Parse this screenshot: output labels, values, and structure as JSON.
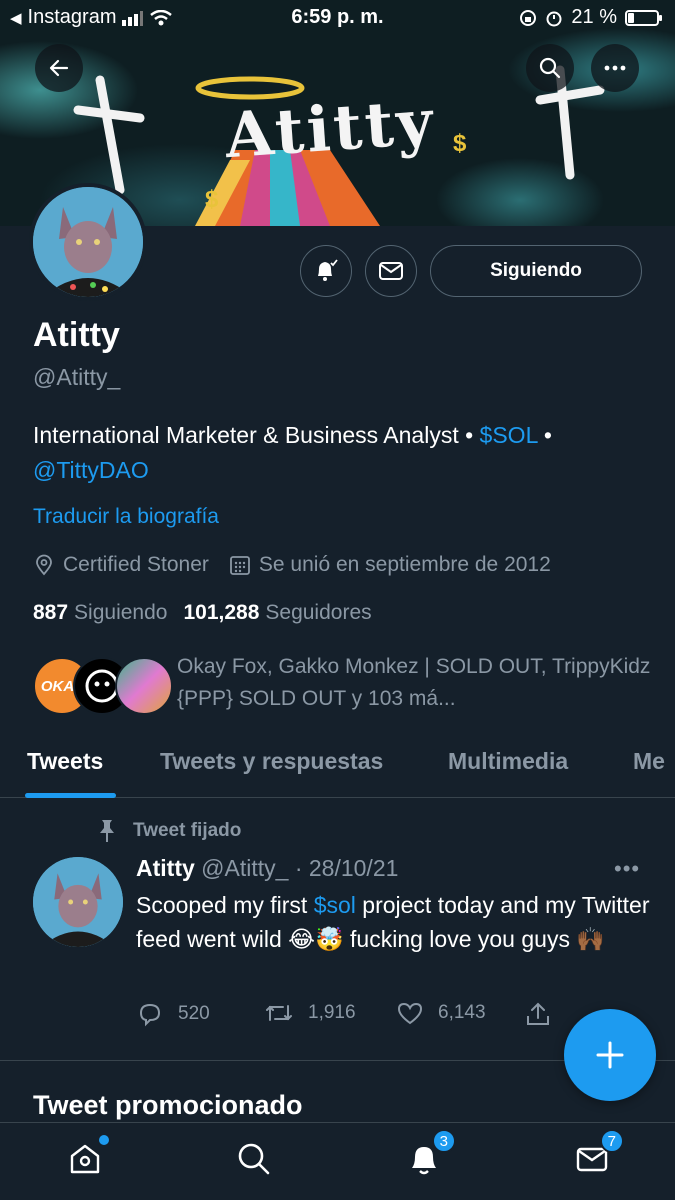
{
  "status_bar": {
    "back_app": "Instagram",
    "time": "6:59 p. m.",
    "battery": "21 %"
  },
  "header_art": {
    "text": "Atitty"
  },
  "profile": {
    "name": "Atitty",
    "handle": "@Atitty_",
    "bio_text": "International Marketer & Business Analyst • ",
    "bio_cashtag": "$SOL",
    "bio_separator": " •",
    "bio_mention": "@TittyDAO",
    "translate_label": "Traducir la biografía",
    "location": "Certified Stoner",
    "joined": "Se unió en septiembre de 2012",
    "following_count": "887",
    "following_label": "Siguiendo",
    "followers_count": "101,288",
    "followers_label": "Seguidores",
    "followed_by": "Okay Fox, Gakko Monkez | SOLD OUT, TrippyKidz {PPP} SOLD OUT y 103 má..."
  },
  "actions": {
    "following_button": "Siguiendo"
  },
  "tabs": [
    {
      "label": "Tweets"
    },
    {
      "label": "Tweets y respuestas"
    },
    {
      "label": "Multimedia"
    },
    {
      "label": "Me"
    }
  ],
  "tweet": {
    "pinned_label": "Tweet fijado",
    "author": "Atitty",
    "handle_date": "@Atitty_ · 28/10/21",
    "text_before": "Scooped my first ",
    "cashtag": "$sol",
    "text_after": " project today and my Twitter feed went wild 😂🤯 fucking love you guys 🙌🏾",
    "replies": "520",
    "retweets": "1,916",
    "likes": "6,143"
  },
  "promo_heading": "Tweet promocionado",
  "nav_badges": {
    "notifications": "3",
    "messages": "7"
  },
  "colors": {
    "background": "#15202b",
    "accent": "#1d9bf0",
    "muted": "#8b98a5",
    "border": "#38444d"
  }
}
